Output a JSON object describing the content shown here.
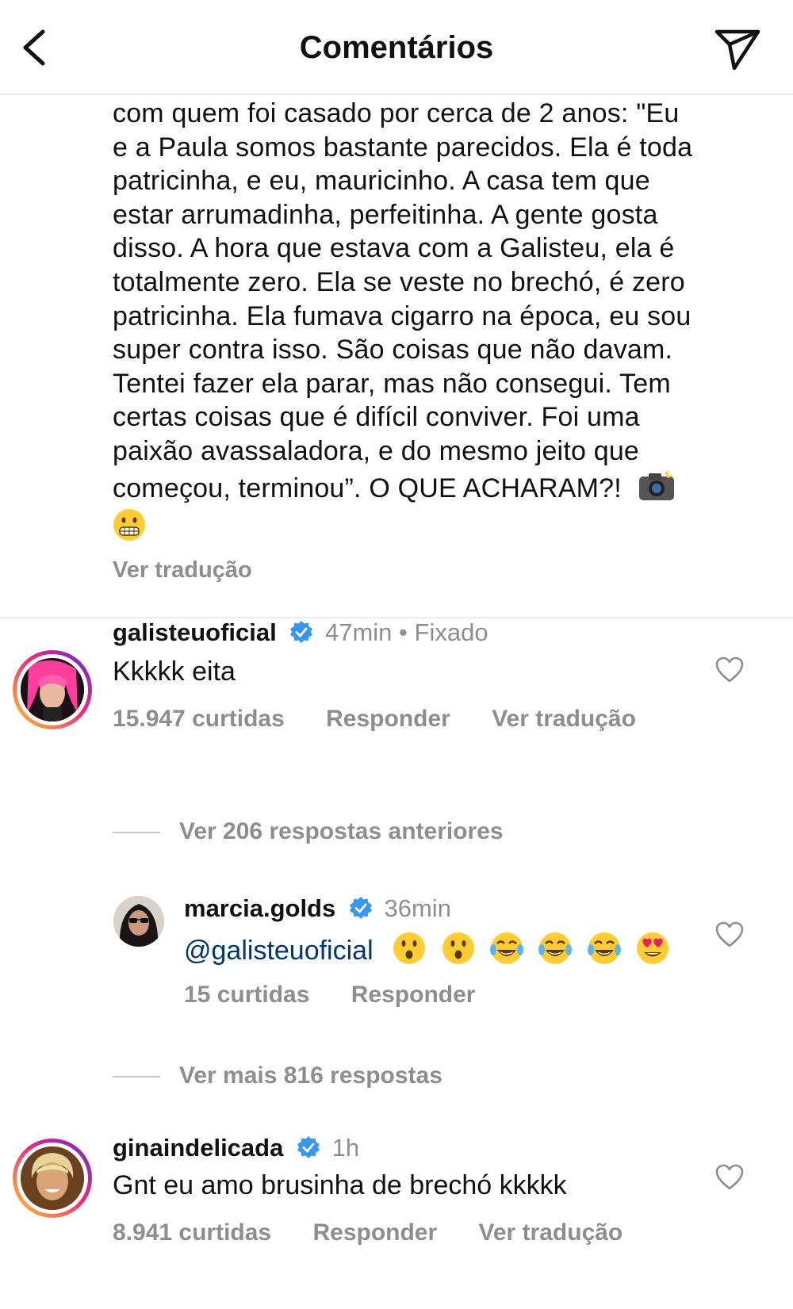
{
  "header": {
    "title": "Comentários"
  },
  "caption": {
    "lines": [
      "com quem foi casado por cerca de 2 anos: \"Eu",
      "e a Paula somos bastante parecidos. Ela é toda",
      "patricinha, e eu, mauricinho. A casa tem que",
      "estar arrumadinha, perfeitinha. A gente gosta",
      "disso. A hora que estava com a Galisteu, ela é",
      "totalmente zero. Ela se veste no brechó, é zero",
      "patricinha. Ela fumava cigarro na época, eu sou",
      "super contra isso. São coisas que não davam.",
      "Tentei fazer ela parar, mas não consegui. Tem",
      "certas coisas que é difícil conviver. Foi uma",
      "paixão avassaladora, e do mesmo jeito que",
      "começou, terminou”. O QUE ACHARAM?!"
    ],
    "see_translation": "Ver tradução"
  },
  "comments": [
    {
      "username": "galisteuoficial",
      "time": "47min",
      "pinned": "• Fixado",
      "text": "Kkkkk eita",
      "likes": "15.947 curtidas",
      "reply": "Responder",
      "translate": "Ver tradução"
    },
    {
      "username": "marcia.golds",
      "time": "36min",
      "mention": "@galisteuoficial",
      "likes": "15 curtidas",
      "reply": "Responder"
    },
    {
      "username": "ginaindelicada",
      "time": "1h",
      "text": "Gnt eu amo brusinha de brechó kkkkk",
      "likes": "8.941 curtidas",
      "reply": "Responder",
      "translate": "Ver tradução"
    }
  ],
  "replies_prev": "Ver 206 respostas anteriores",
  "replies_more": "Ver mais 816 respostas",
  "icons": {
    "back": "chevron-left-icon",
    "send": "paper-plane-icon",
    "verified": "verified-badge-icon",
    "like": "heart-outline-icon"
  },
  "colors": {
    "verified": "#3897f0",
    "secondary_text": "#8e8e8e",
    "mention": "#00376b",
    "story_ring_start": "#f9ce34",
    "story_ring_end": "#ee2a7b"
  }
}
